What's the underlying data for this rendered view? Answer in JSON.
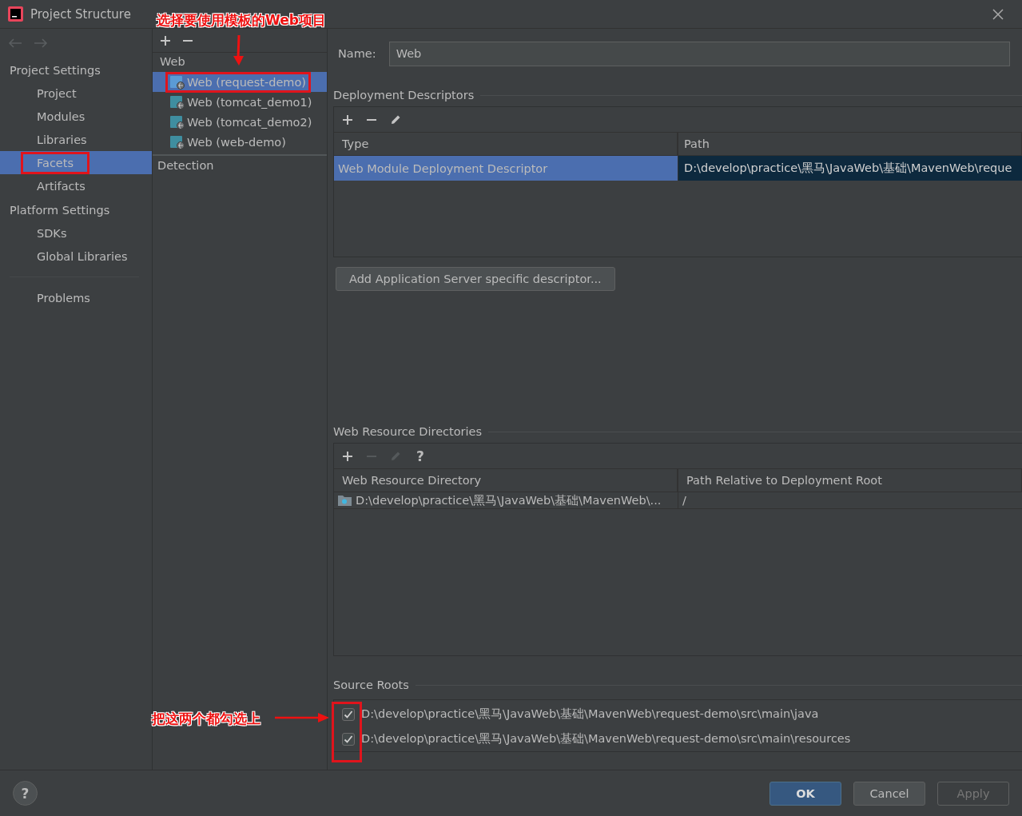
{
  "window": {
    "title": "Project Structure"
  },
  "sidebar": {
    "groups": [
      {
        "heading": "Project Settings",
        "items": [
          {
            "label": "Project",
            "selected": false,
            "highlighted": false
          },
          {
            "label": "Modules",
            "selected": false,
            "highlighted": false
          },
          {
            "label": "Libraries",
            "selected": false,
            "highlighted": false
          },
          {
            "label": "Facets",
            "selected": true,
            "highlighted": true
          },
          {
            "label": "Artifacts",
            "selected": false,
            "highlighted": false
          }
        ]
      },
      {
        "heading": "Platform Settings",
        "items": [
          {
            "label": "SDKs",
            "selected": false,
            "highlighted": false
          },
          {
            "label": "Global Libraries",
            "selected": false,
            "highlighted": false
          }
        ]
      }
    ],
    "extra_items": [
      {
        "label": "Problems",
        "selected": false,
        "highlighted": false
      }
    ]
  },
  "facets": {
    "heading": "Web",
    "items": [
      {
        "label": "Web (request-demo)",
        "selected": true,
        "highlighted": true
      },
      {
        "label": "Web (tomcat_demo1)",
        "selected": false,
        "highlighted": false
      },
      {
        "label": "Web (tomcat_demo2)",
        "selected": false,
        "highlighted": false
      },
      {
        "label": "Web (web-demo)",
        "selected": false,
        "highlighted": false
      }
    ],
    "detection": "Detection"
  },
  "name_field": {
    "label": "Name:",
    "value": "Web"
  },
  "deployment_descriptors": {
    "title": "Deployment Descriptors",
    "toolbar": [
      {
        "kind": "add",
        "disabled": false
      },
      {
        "kind": "remove",
        "disabled": false
      },
      {
        "kind": "edit",
        "disabled": false
      }
    ],
    "columns": [
      "Type",
      "Path"
    ],
    "rows": [
      {
        "cells": [
          "Web Module Deployment Descriptor",
          "D:\\develop\\practice\\黑马\\JavaWeb\\基础\\MavenWeb\\reque"
        ],
        "selected": true
      }
    ]
  },
  "add_descriptor_button": {
    "label": "Add Application Server specific descriptor..."
  },
  "web_resource_directories": {
    "title": "Web Resource Directories",
    "toolbar": [
      {
        "kind": "add",
        "disabled": false
      },
      {
        "kind": "remove",
        "disabled": true
      },
      {
        "kind": "edit",
        "disabled": true
      },
      {
        "kind": "help",
        "label": "?",
        "disabled": false
      }
    ],
    "columns": [
      "Web Resource Directory",
      "Path Relative to Deployment Root"
    ],
    "rows": [
      {
        "cells": [
          "D:\\develop\\practice\\黑马\\JavaWeb\\基础\\MavenWeb\\...",
          "/"
        ],
        "selected": false
      }
    ]
  },
  "source_roots": {
    "title": "Source Roots",
    "highlighted": true,
    "items": [
      {
        "path": "D:\\develop\\practice\\黑马\\JavaWeb\\基础\\MavenWeb\\request-demo\\src\\main\\java",
        "checked": true
      },
      {
        "path": "D:\\develop\\practice\\黑马\\JavaWeb\\基础\\MavenWeb\\request-demo\\src\\main\\resources",
        "checked": true
      }
    ]
  },
  "help_button": {
    "label": "?"
  },
  "buttons": [
    {
      "label": "OK",
      "kind": "primary",
      "disabled": false
    },
    {
      "label": "Cancel",
      "kind": "secondary",
      "disabled": false
    },
    {
      "label": "Apply",
      "kind": "secondary",
      "disabled": true
    }
  ],
  "annotations": [
    {
      "kind": "top",
      "text": "选择要使用模板的Web项目"
    },
    {
      "kind": "left",
      "text": "把这两个都勾选上"
    }
  ]
}
